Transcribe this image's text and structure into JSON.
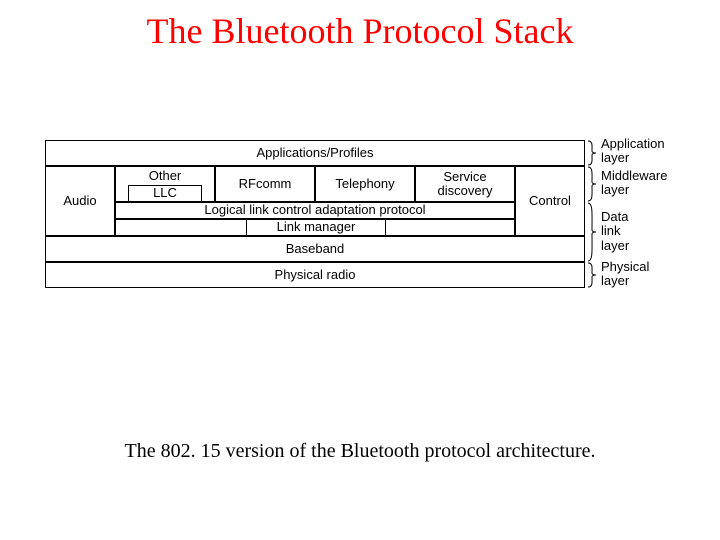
{
  "title": "The Bluetooth Protocol Stack",
  "caption": "The 802. 15 version of the Bluetooth protocol architecture.",
  "stack": {
    "applications": "Applications/Profiles",
    "audio": "Audio",
    "other": "Other",
    "llc": "LLC",
    "rfcomm": "RFcomm",
    "telephony": "Telephony",
    "service_discovery": "Service\ndiscovery",
    "control": "Control",
    "l2cap": "Logical link control adaptation protocol",
    "link_manager": "Link manager",
    "baseband": "Baseband",
    "physical_radio": "Physical radio"
  },
  "layers": {
    "application": "Application\nlayer",
    "middleware": "Middleware\nlayer",
    "data_link": "Data\nlink\nlayer",
    "physical": "Physical\nlayer"
  },
  "chart_data": {
    "type": "table",
    "title": "The Bluetooth Protocol Stack",
    "rows": [
      {
        "element": "Applications/Profiles",
        "layer": "Application layer"
      },
      {
        "element": "Audio",
        "layer": "Middleware layer"
      },
      {
        "element": "Other",
        "layer": "Middleware layer"
      },
      {
        "element": "LLC",
        "layer": "Middleware layer"
      },
      {
        "element": "RFcomm",
        "layer": "Middleware layer"
      },
      {
        "element": "Telephony",
        "layer": "Middleware layer"
      },
      {
        "element": "Service discovery",
        "layer": "Middleware layer"
      },
      {
        "element": "Control",
        "layer": "Middleware layer"
      },
      {
        "element": "Logical link control adaptation protocol",
        "layer": "Data link layer"
      },
      {
        "element": "Link manager",
        "layer": "Data link layer"
      },
      {
        "element": "Baseband",
        "layer": "Data link layer"
      },
      {
        "element": "Physical radio",
        "layer": "Physical layer"
      }
    ]
  }
}
